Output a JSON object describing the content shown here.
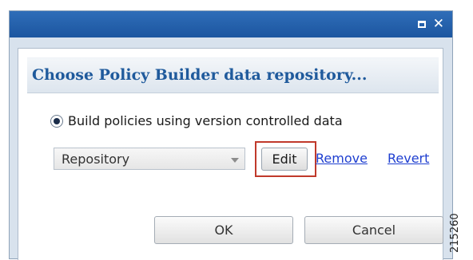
{
  "window": {
    "controls": {
      "maximize_icon": "maximize-icon",
      "close_label": "✕"
    }
  },
  "dialog": {
    "heading": "Choose Policy Builder data repository...",
    "radio_label": "Build policies using version controlled data",
    "repository_select": {
      "value": "Repository"
    },
    "edit_label": "Edit",
    "remove_label": "Remove",
    "revert_label": "Revert",
    "ok_label": "OK",
    "cancel_label": "Cancel"
  },
  "figure_id": "215260",
  "colors": {
    "titlebar": "#1c56a0",
    "heading_text": "#1f5a9c",
    "link": "#1f3fd0",
    "highlight": "#c0392b"
  }
}
